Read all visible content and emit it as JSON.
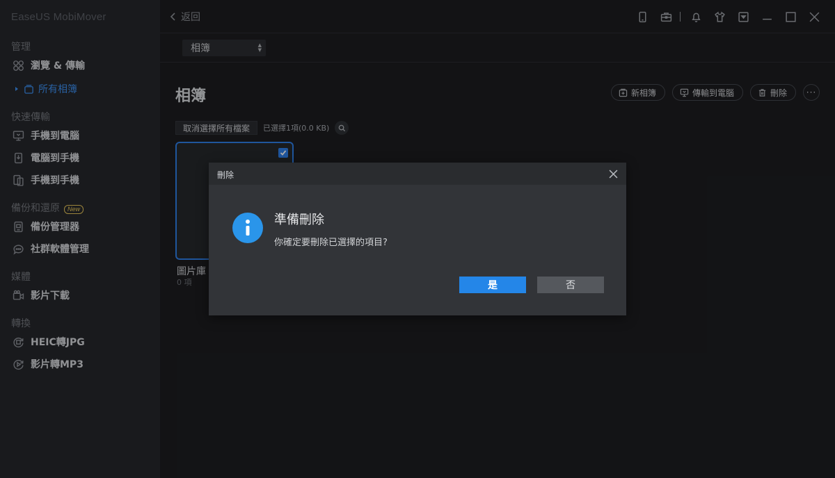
{
  "app": {
    "title": "EaseUS MobiMover"
  },
  "sidebar": {
    "sections": [
      {
        "label": "管理"
      },
      {
        "label": "快速傳輸"
      },
      {
        "label": "備份和還原",
        "badge": "New"
      },
      {
        "label": "媒體"
      },
      {
        "label": "轉換"
      }
    ],
    "items": [
      {
        "label": "瀏覽 & 傳輸",
        "icon": "grid-icon"
      },
      {
        "label": "所有相簿",
        "icon": "album-icon"
      },
      {
        "label": "手機到電腦",
        "icon": "phone-to-pc-icon"
      },
      {
        "label": "電腦到手機",
        "icon": "pc-to-phone-icon"
      },
      {
        "label": "手機到手機",
        "icon": "phone-to-phone-icon"
      },
      {
        "label": "備份管理器",
        "icon": "backup-manager-icon"
      },
      {
        "label": "社群軟體管理",
        "icon": "chat-icon"
      },
      {
        "label": "影片下載",
        "icon": "video-download-icon"
      },
      {
        "label": "HEIC轉JPG",
        "icon": "heic-convert-icon"
      },
      {
        "label": "影片轉MP3",
        "icon": "mp3-convert-icon"
      }
    ]
  },
  "topbar": {
    "back_label": "返回",
    "icons": [
      "device-icon",
      "toolbox-icon",
      "bell-icon",
      "shirt-icon",
      "dropdown-menu-icon",
      "minimize-icon",
      "maximize-icon",
      "close-icon"
    ]
  },
  "subbar": {
    "select_value": "相簿"
  },
  "content": {
    "title": "相簿",
    "actions": {
      "new_album": "新相簿",
      "transfer_to_pc": "傳輸到電腦",
      "delete": "刪除",
      "more": "···"
    },
    "deselect_label": "取消選擇所有檔案",
    "selection_info": "已選擇1項(0.0 KB)",
    "album": {
      "name": "圖片庫",
      "count": "0 項",
      "selected": true
    }
  },
  "dialog": {
    "title": "刪除",
    "heading": "準備刪除",
    "message": "你確定要刪除已選擇的項目?",
    "yes_label": "是",
    "no_label": "否"
  },
  "colors": {
    "accent": "#2486e8",
    "sidebar_bg": "#25272b",
    "main_bg": "#1c1d20",
    "dialog_bg": "#323438",
    "badge": "#e8c65a"
  }
}
